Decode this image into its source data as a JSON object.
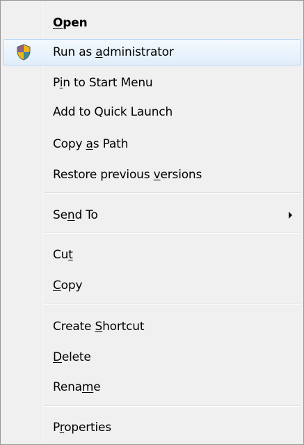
{
  "menu": {
    "items": [
      {
        "id": "open",
        "pre": "",
        "key": "O",
        "post": "pen",
        "bold": true
      },
      {
        "id": "run-as-administrator",
        "pre": "Run as ",
        "key": "a",
        "post": "dministrator",
        "icon": "uac-shield-icon",
        "highlighted": true
      },
      {
        "id": "pin-to-start-menu",
        "pre": "P",
        "key": "i",
        "post": "n to Start Menu"
      },
      {
        "id": "add-to-quick-launch",
        "pre": "Add to Quick Launch",
        "key": "",
        "post": ""
      },
      {
        "id": "copy-as-path",
        "pre": "Copy ",
        "key": "a",
        "post": "s Path"
      },
      {
        "id": "restore-previous-versions",
        "pre": "Restore previous ",
        "key": "v",
        "post": "ersions"
      },
      {
        "id": "send-to",
        "pre": "Se",
        "key": "n",
        "post": "d To",
        "submenu": true,
        "submenu_icon": "submenu-arrow-icon"
      },
      {
        "id": "cut",
        "pre": "Cu",
        "key": "t",
        "post": ""
      },
      {
        "id": "copy",
        "pre": "",
        "key": "C",
        "post": "opy"
      },
      {
        "id": "create-shortcut",
        "pre": "Create ",
        "key": "S",
        "post": "hortcut"
      },
      {
        "id": "delete",
        "pre": "",
        "key": "D",
        "post": "elete"
      },
      {
        "id": "rename",
        "pre": "Rena",
        "key": "m",
        "post": "e"
      },
      {
        "id": "properties",
        "pre": "P",
        "key": "r",
        "post": "operties"
      }
    ]
  },
  "colors": {
    "menu_background": "#f0f0f0",
    "menu_border": "#979797",
    "highlight_border": "#b4d3f3",
    "highlight_fill": "#e0eefb"
  }
}
